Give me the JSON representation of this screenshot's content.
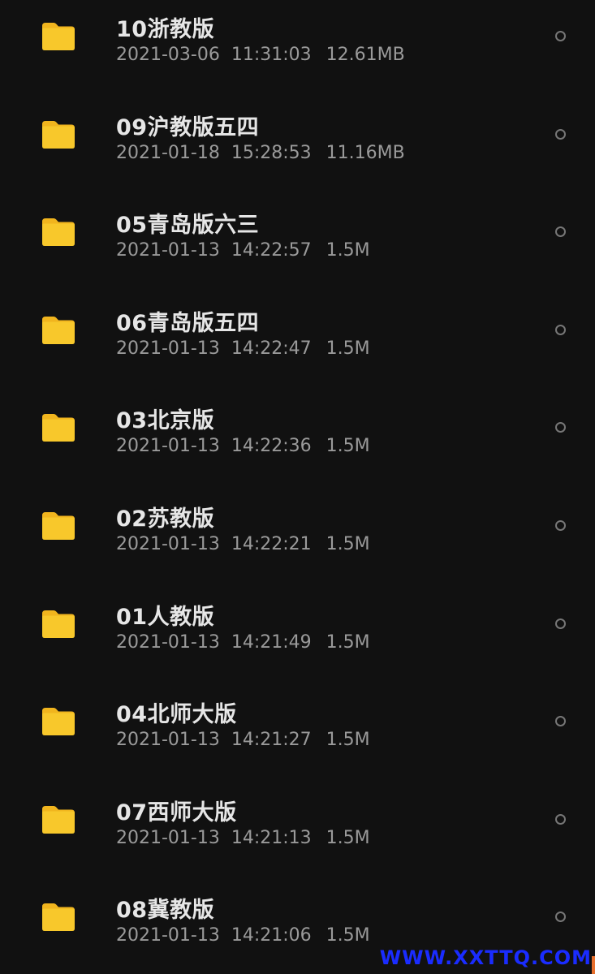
{
  "files": [
    {
      "name": "10浙教版",
      "date": "2021-03-06",
      "time": "11:31:03",
      "size": "12.61MB",
      "icon": "folder-icon"
    },
    {
      "name": "09沪教版五四",
      "date": "2021-01-18",
      "time": "15:28:53",
      "size": "11.16MB",
      "icon": "folder-icon"
    },
    {
      "name": "05青岛版六三",
      "date": "2021-01-13",
      "time": "14:22:57",
      "size": "1.5M",
      "icon": "folder-icon"
    },
    {
      "name": "06青岛版五四",
      "date": "2021-01-13",
      "time": "14:22:47",
      "size": "1.5M",
      "icon": "folder-icon"
    },
    {
      "name": "03北京版",
      "date": "2021-01-13",
      "time": "14:22:36",
      "size": "1.5M",
      "icon": "folder-icon"
    },
    {
      "name": "02苏教版",
      "date": "2021-01-13",
      "time": "14:22:21",
      "size": "1.5M",
      "icon": "folder-icon"
    },
    {
      "name": "01人教版",
      "date": "2021-01-13",
      "time": "14:21:49",
      "size": "1.5M",
      "icon": "folder-icon"
    },
    {
      "name": "04北师大版",
      "date": "2021-01-13",
      "time": "14:21:27",
      "size": "1.5M",
      "icon": "folder-icon"
    },
    {
      "name": "07西师大版",
      "date": "2021-01-13",
      "time": "14:21:13",
      "size": "1.5M",
      "icon": "folder-icon"
    },
    {
      "name": "08冀教版",
      "date": "2021-01-13",
      "time": "14:21:06",
      "size": "1.5M",
      "icon": "folder-icon"
    }
  ],
  "watermark": "WWW.XXTTQ.COM",
  "colors": {
    "background": "#111111",
    "folder": "#f8c82b",
    "folder_tab": "#f1b51e",
    "title_text": "#e6e6e6",
    "meta_text": "#9a9a9a",
    "watermark": "#1a2cff"
  }
}
